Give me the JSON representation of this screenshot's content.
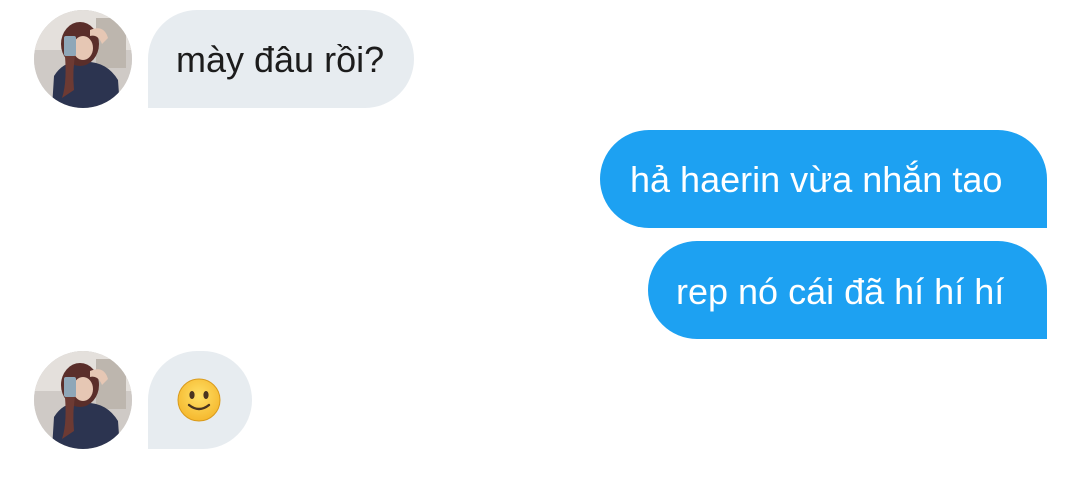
{
  "conversation": {
    "messages": [
      {
        "sender": "them",
        "text": "mày đâu rồi?"
      },
      {
        "sender": "me",
        "text": "hả haerin vừa nhắn tao"
      },
      {
        "sender": "me",
        "text": "rep nó cái đã hí hí hí"
      },
      {
        "sender": "them",
        "emoji": "slightly-smiling-face"
      }
    ]
  },
  "colors": {
    "incoming_bubble": "#e7ecf0",
    "outgoing_bubble": "#1da1f2",
    "incoming_text": "#1c1c1c",
    "outgoing_text": "#ffffff"
  }
}
